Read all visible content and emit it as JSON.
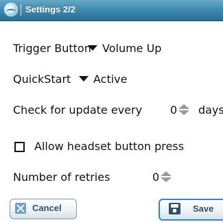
{
  "window": {
    "title": "Settings 2/2"
  },
  "settings": {
    "trigger_button": {
      "label": "Trigger Button",
      "value": "Volume Up"
    },
    "quickstart": {
      "label": "QuickStart",
      "value": "Active"
    },
    "update": {
      "label": "Check for update every",
      "value": "0",
      "unit": "days"
    },
    "headset": {
      "label": "Allow headset button press",
      "checked": false
    },
    "retries": {
      "label": "Number of retries",
      "value": "0"
    }
  },
  "buttons": {
    "cancel": "Cancel",
    "save": "Save"
  },
  "icons": {
    "app": "app-icon",
    "dropdown": "dropdown-arrow-icon",
    "spinner": "spinner-icon",
    "cancel": "close-icon",
    "save": "save-icon"
  },
  "colors": {
    "titlebar": "#3d87ad",
    "title_text": "#ffffff",
    "save_border": "#2d89c4",
    "button_text": "#2f4f6b"
  }
}
